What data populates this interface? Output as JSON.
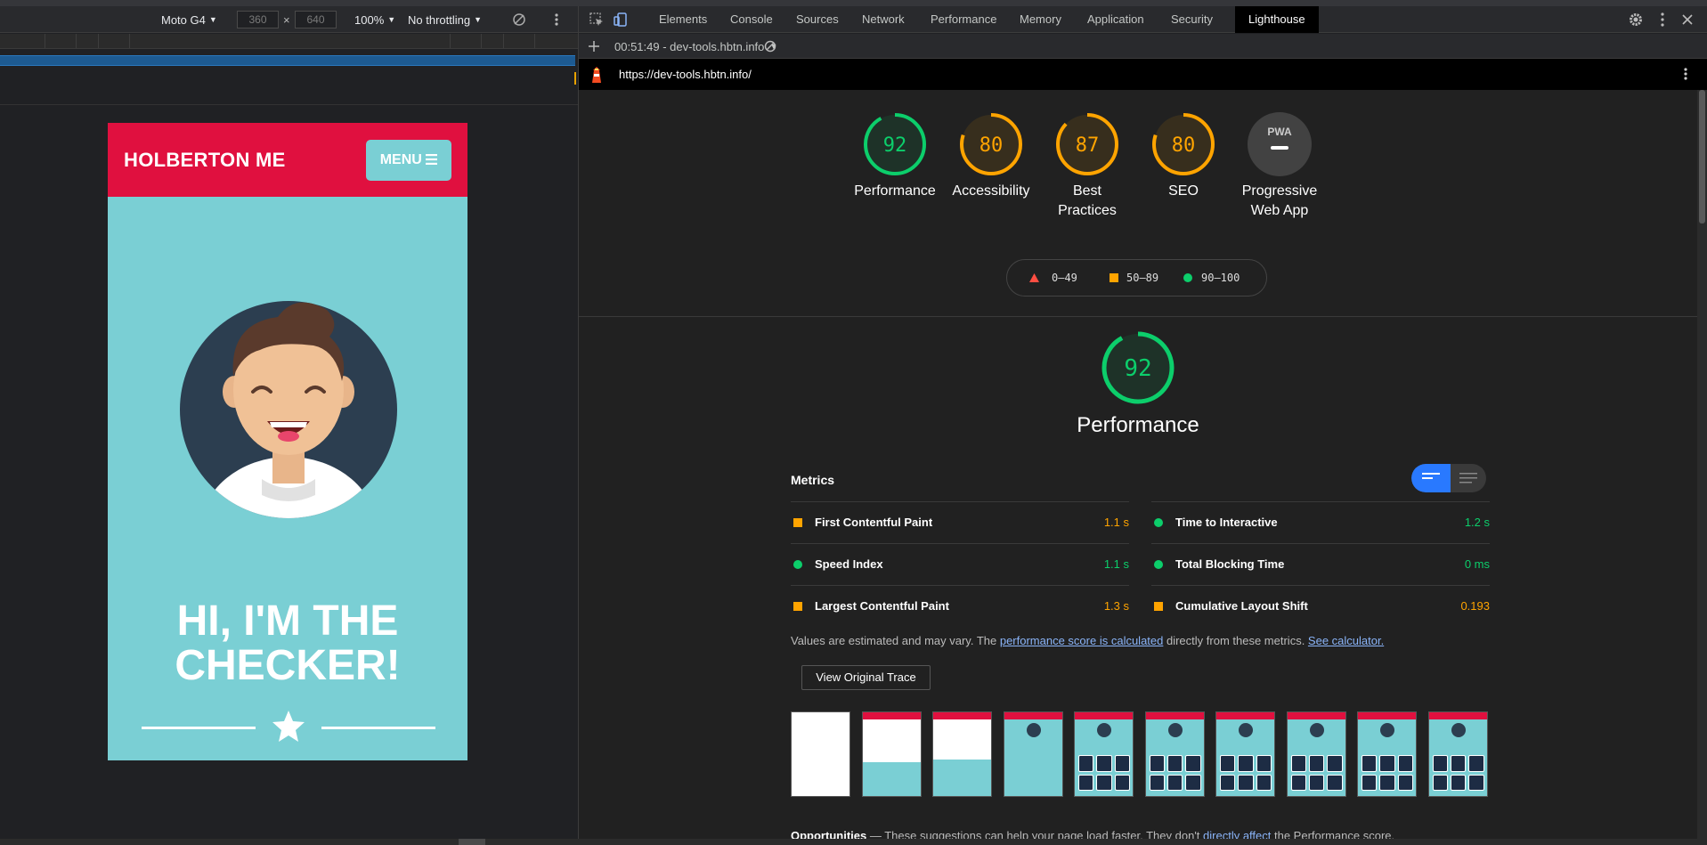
{
  "device_toolbar": {
    "device": "Moto G4",
    "width": "360",
    "height": "640",
    "times": "×",
    "zoom": "100%",
    "throttling": "No throttling"
  },
  "phone": {
    "brand": "HOLBERTON ME",
    "menu_label": "MENU",
    "menu_icon": "hamburger-icon",
    "headline": "HI, I'M THE CHECKER!",
    "colors": {
      "header": "#e0103f",
      "body": "#7acfd4"
    }
  },
  "devtools": {
    "tabs": [
      "Elements",
      "Console",
      "Sources",
      "Network",
      "Performance",
      "Memory",
      "Application",
      "Security",
      "Lighthouse"
    ],
    "active_tab": "Lighthouse",
    "report_selector": "00:51:49 - dev-tools.hbtn.info",
    "url": "https://dev-tools.hbtn.info/"
  },
  "gauges": [
    {
      "score": "92",
      "label": "Performance",
      "value": 0.92,
      "color": "#0cce6b"
    },
    {
      "score": "80",
      "label": "Accessibility",
      "value": 0.8,
      "color": "#ffa400"
    },
    {
      "score": "87",
      "label": "Best Practices",
      "value": 0.87,
      "color": "#ffa400"
    },
    {
      "score": "80",
      "label": "SEO",
      "value": 0.8,
      "color": "#ffa400"
    },
    {
      "score": "PWA",
      "label": "Progressive Web App",
      "value": 0,
      "color": "#9aa0a6"
    }
  ],
  "legend": {
    "fail": "0–49",
    "average": "50–89",
    "pass": "90–100"
  },
  "performance": {
    "score": "92",
    "value": 0.92,
    "title": "Performance",
    "metrics_heading": "Metrics",
    "metrics": [
      {
        "name": "First Contentful Paint",
        "value": "1.1 s",
        "status": "average"
      },
      {
        "name": "Time to Interactive",
        "value": "1.2 s",
        "status": "pass"
      },
      {
        "name": "Speed Index",
        "value": "1.1 s",
        "status": "pass"
      },
      {
        "name": "Total Blocking Time",
        "value": "0 ms",
        "status": "pass"
      },
      {
        "name": "Largest Contentful Paint",
        "value": "1.3 s",
        "status": "average"
      },
      {
        "name": "Cumulative Layout Shift",
        "value": "0.193",
        "status": "average"
      }
    ],
    "note_prefix": "Values are estimated and may vary. The ",
    "note_link1": "performance score is calculated",
    "note_middle": " directly from these metrics. ",
    "note_link2": "See calculator.",
    "trace_button": "View Original Trace",
    "opps_title": "Opportunities",
    "opps_text1": " — These suggestions can help your page load faster. They don't ",
    "opps_link": "directly affect",
    "opps_text2": " the Performance score."
  }
}
